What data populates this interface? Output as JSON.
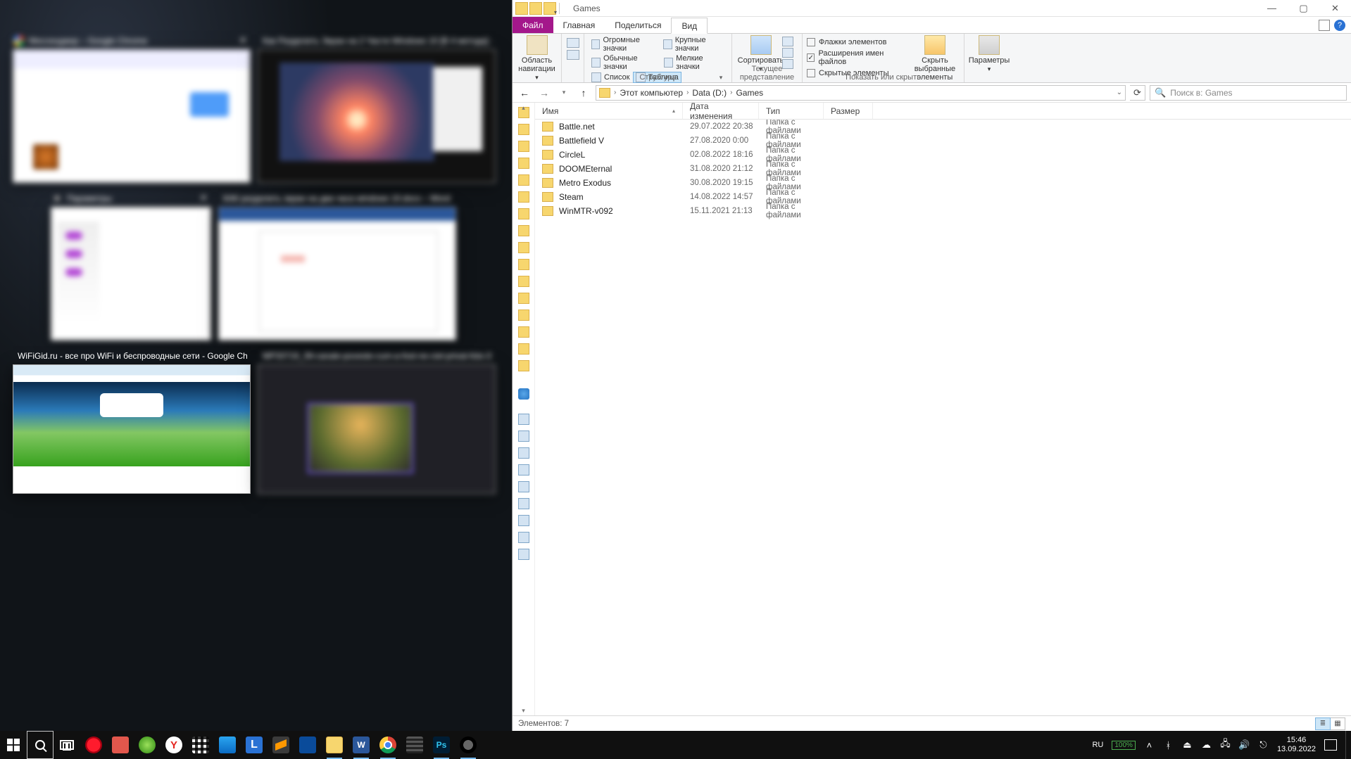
{
  "snap_titles": {
    "t1": "Мессенджер – Google Chrome",
    "t2": "Как Разделить Экран на 2 Части Windows 10 [В 4 метода] — Р...",
    "t3": "Параметры",
    "t4": "КАК разделить экран на два часа windows 10.docx – Word (Сб...)",
    "t5": "WiFiGid.ru - все про WiFi и беспроводные сети - Google Chrome",
    "t6": "MP33719_39-canale-poveste-cum-a-fost-ne-ciel-privat-foto-37.jp..."
  },
  "explorer": {
    "title": "Games",
    "tabs": {
      "file": "Файл",
      "home": "Главная",
      "share": "Поделиться",
      "view": "Вид"
    },
    "ribbon": {
      "nav_pane": "Область навигации",
      "layout": {
        "huge": "Огромные значки",
        "large": "Крупные значки",
        "medium": "Обычные значки",
        "small": "Мелкие значки",
        "list": "Список",
        "table": "Таблица",
        "group": "Структура"
      },
      "cur_view_group": "Текущее представление",
      "sort": "Сортировать",
      "show_hide": {
        "flags": "Флажки элементов",
        "ext": "Расширения имен файлов",
        "hidden": "Скрытые элементы",
        "hide_selected_1": "Скрыть выбранные",
        "hide_selected_2": "элементы",
        "group": "Показать или скрыть"
      },
      "params": "Параметры"
    },
    "breadcrumbs": [
      "Этот компьютер",
      "Data (D:)",
      "Games"
    ],
    "search_placeholder": "Поиск в: Games",
    "columns": {
      "name": "Имя",
      "date": "Дата изменения",
      "type": "Тип",
      "size": "Размер"
    },
    "rows": [
      {
        "name": "Battle.net",
        "date": "29.07.2022 20:38",
        "type": "Папка с файлами"
      },
      {
        "name": "Battlefield V",
        "date": "27.08.2020 0:00",
        "type": "Папка с файлами"
      },
      {
        "name": "CircleL",
        "date": "02.08.2022 18:16",
        "type": "Папка с файлами"
      },
      {
        "name": "DOOMEternal",
        "date": "31.08.2020 21:12",
        "type": "Папка с файлами"
      },
      {
        "name": "Metro Exodus",
        "date": "30.08.2020 19:15",
        "type": "Папка с файлами"
      },
      {
        "name": "Steam",
        "date": "14.08.2022 14:57",
        "type": "Папка с файлами"
      },
      {
        "name": "WinMTR-v092",
        "date": "15.11.2021 21:13",
        "type": "Папка с файлами"
      }
    ],
    "status": "Элементов: 7"
  },
  "taskbar": {
    "lang": "RU",
    "battery": "100%",
    "time": "15:46",
    "date": "13.09.2022"
  }
}
